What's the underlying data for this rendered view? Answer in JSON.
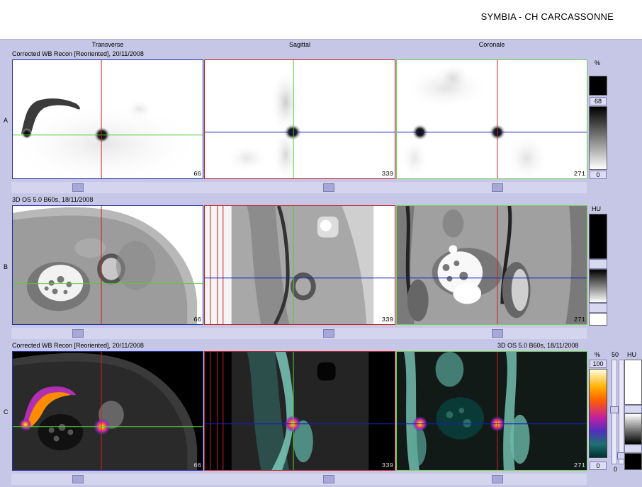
{
  "header": {
    "title": "SYMBIA - CH CARCASSONNE"
  },
  "columns": {
    "transverse": "Transverse",
    "sagittal": "Sagittal",
    "coronal": "Coronale"
  },
  "rows": {
    "a": {
      "letter": "A",
      "caption": "Corrected WB Recon [Reoriented], 20/11/2008"
    },
    "b": {
      "letter": "B",
      "caption": "3D  OS  5.0  B60s, 18/11/2008"
    },
    "c": {
      "letter": "C",
      "caption_left": "Corrected WB Recon [Reoriented], 20/11/2008",
      "caption_right": "3D  OS  5.0  B60s, 18/11/2008"
    }
  },
  "slices": {
    "transverse": "66",
    "sagittal": "339",
    "coronal": "271"
  },
  "colorbars": {
    "a": {
      "unit": "%",
      "upper": "68",
      "lower": "0"
    },
    "b": {
      "unit": "HU"
    },
    "c": {
      "unit_left": "%",
      "top": "100",
      "bottom": "0",
      "mid": "50",
      "unit_right": "HU",
      "right_bottom": "0"
    }
  },
  "colors": {
    "crosshair_red": "#d02020",
    "crosshair_green": "#50d030",
    "crosshair_blue": "#1020c0",
    "panel_border": "#3040a0",
    "background": "#c6c6e6"
  }
}
